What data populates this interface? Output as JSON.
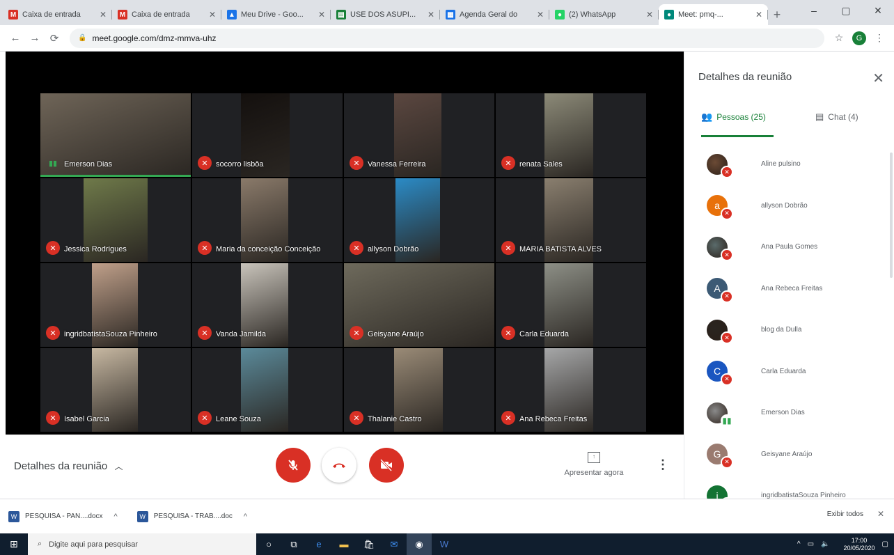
{
  "browser": {
    "tabs": [
      {
        "title": "Caixa de entrada",
        "icon": "gmail-icon",
        "color": "#d93025",
        "letter": "M"
      },
      {
        "title": "Caixa de entrada",
        "icon": "gmail-icon",
        "color": "#d93025",
        "letter": "M"
      },
      {
        "title": "Meu Drive - Goo...",
        "icon": "drive-icon",
        "color": "#1a73e8",
        "letter": "▲"
      },
      {
        "title": "USE DOS ASUPI...",
        "icon": "sheets-icon",
        "color": "#188038",
        "letter": "▤"
      },
      {
        "title": "Agenda Geral do",
        "icon": "calendar-icon",
        "color": "#1a73e8",
        "letter": "▦"
      },
      {
        "title": "(2) WhatsApp",
        "icon": "whatsapp-icon",
        "color": "#25d366",
        "letter": "●"
      },
      {
        "title": "Meet: pmq-...",
        "icon": "meet-icon",
        "color": "#00897b",
        "letter": "●"
      }
    ],
    "url": "meet.google.com/dmz-mmva-uhz",
    "profile_letter": "G"
  },
  "tiles": [
    {
      "name": "Emerson Dias",
      "muted": false,
      "speaking": true,
      "bg": "#5b5750",
      "vcolor": "#6f6558",
      "vleft": 0,
      "vwidth": 216
    },
    {
      "name": "socorro lisbôa",
      "muted": true,
      "bg": "#202124",
      "vcolor": "#14100e",
      "vleft": 70,
      "vwidth": 70
    },
    {
      "name": "Vanessa Ferreira",
      "muted": true,
      "bg": "#202124",
      "vcolor": "#5b4740",
      "vleft": 72,
      "vwidth": 68
    },
    {
      "name": "renata Sales",
      "muted": true,
      "bg": "#202124",
      "vcolor": "#8c8a78",
      "vleft": 70,
      "vwidth": 70
    },
    {
      "name": "Jessica Rodrigues",
      "muted": true,
      "bg": "#202124",
      "vcolor": "#6f7a4a",
      "vleft": 62,
      "vwidth": 92
    },
    {
      "name": "Maria da conceição Conceição",
      "muted": true,
      "bg": "#202124",
      "vcolor": "#8a7a6a",
      "vleft": 70,
      "vwidth": 68
    },
    {
      "name": "allyson Dobrão",
      "muted": true,
      "bg": "#202124",
      "vcolor": "#2b8bc6",
      "vleft": 74,
      "vwidth": 64
    },
    {
      "name": "MARIA BATISTA ALVES",
      "muted": true,
      "bg": "#202124",
      "vcolor": "#8a7f6f",
      "vleft": 70,
      "vwidth": 70
    },
    {
      "name": "ingridbatistaSouza Pinheiro",
      "muted": true,
      "bg": "#202124",
      "vcolor": "#c0a08a",
      "vleft": 74,
      "vwidth": 66
    },
    {
      "name": "Vanda Jamilda",
      "muted": true,
      "bg": "#202124",
      "vcolor": "#c9c4bb",
      "vleft": 70,
      "vwidth": 68
    },
    {
      "name": "Geisyane Araújo",
      "muted": true,
      "bg": "#202124",
      "vcolor": "#6e6a5c",
      "vleft": 0,
      "vwidth": 216
    },
    {
      "name": "Carla Eduarda",
      "muted": true,
      "bg": "#202124",
      "vcolor": "#8d8f86",
      "vleft": 70,
      "vwidth": 70
    },
    {
      "name": "Isabel Garcia",
      "muted": true,
      "bg": "#202124",
      "vcolor": "#c7b8a2",
      "vleft": 74,
      "vwidth": 66
    },
    {
      "name": "Leane Souza",
      "muted": true,
      "bg": "#202124",
      "vcolor": "#5b8a9a",
      "vleft": 70,
      "vwidth": 68
    },
    {
      "name": "Thalanie Castro",
      "muted": true,
      "bg": "#202124",
      "vcolor": "#9a8b77",
      "vleft": 72,
      "vwidth": 70
    },
    {
      "name": "Ana Rebeca Freitas",
      "muted": true,
      "bg": "#202124",
      "vcolor": "#a6a7a8",
      "vleft": 70,
      "vwidth": 70
    }
  ],
  "controls": {
    "meeting_details": "Detalhes da reunião",
    "present_label": "Apresentar agora"
  },
  "sidebar": {
    "title": "Detalhes da reunião",
    "people_tab": "Pessoas (25)",
    "chat_tab": "Chat (4)",
    "people": [
      {
        "name": "Aline pulsino",
        "avatar": "photo",
        "color": "#6b4a35",
        "letter": "",
        "muted": true
      },
      {
        "name": "allyson Dobrão",
        "avatar": "letter",
        "color": "#e8710a",
        "letter": "a",
        "muted": true
      },
      {
        "name": "Ana Paula Gomes",
        "avatar": "photo",
        "color": "#5a6b6b",
        "letter": "",
        "muted": true
      },
      {
        "name": "Ana Rebeca Freitas",
        "avatar": "letter",
        "color": "#3c5a75",
        "letter": "A",
        "muted": true
      },
      {
        "name": "blog da Dulla",
        "avatar": "photo",
        "color": "#2a2520",
        "letter": "",
        "muted": true
      },
      {
        "name": "Carla Eduarda",
        "avatar": "letter",
        "color": "#1a56c0",
        "letter": "C",
        "muted": true
      },
      {
        "name": "Emerson Dias",
        "avatar": "photo",
        "color": "#8a8a8a",
        "letter": "",
        "muted": false
      },
      {
        "name": "Geisyane Araújo",
        "avatar": "letter",
        "color": "#9a7b70",
        "letter": "G",
        "muted": true
      },
      {
        "name": "ingridbatistaSouza Pinheiro",
        "avatar": "letter",
        "color": "#137333",
        "letter": "i",
        "muted": true
      }
    ]
  },
  "downloads": {
    "items": [
      "PESQUISA - PAN....docx",
      "PESQUISA - TRAB....doc"
    ],
    "show_all": "Exibir todos"
  },
  "taskbar": {
    "search_placeholder": "Digite aqui para pesquisar",
    "time": "17:00",
    "date": "20/05/2020"
  }
}
